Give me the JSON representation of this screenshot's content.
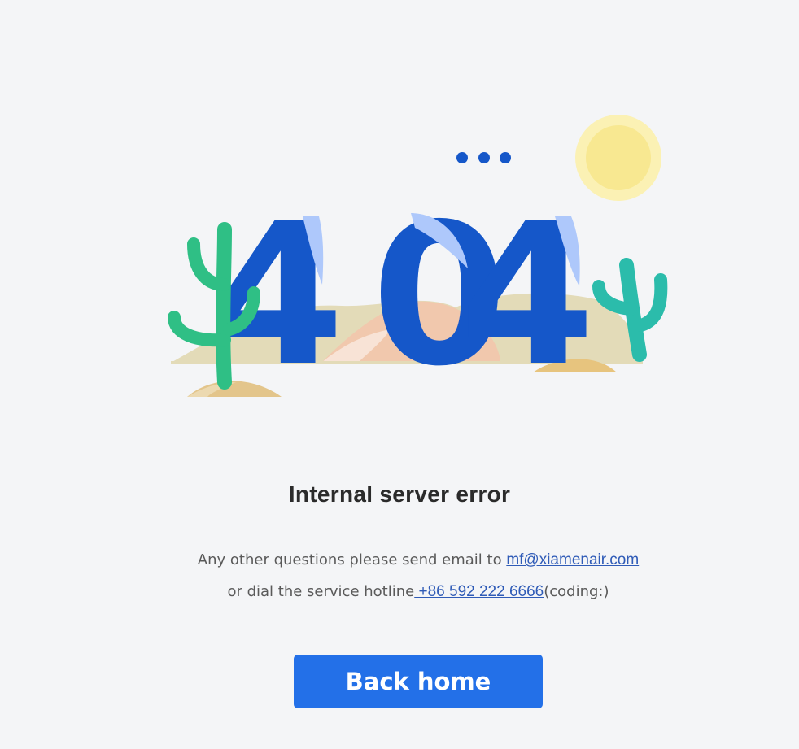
{
  "illustration": {
    "code": "404",
    "colors": {
      "digits": "#1557c9",
      "digit_highlight": "#aec8fb",
      "sun": "#f8e891",
      "sun_glow": "#fbf1b4",
      "cactus_left": "#2fbf85",
      "cactus_right": "#2bbcab",
      "sand": "#e3dbb8",
      "sand_pink": "#f1c8ad",
      "dune": "#e7c47e"
    }
  },
  "error": {
    "title": "Internal server error",
    "email_prefix": "Any other questions please send email to ",
    "email": "mf@xiamenair.com",
    "hotline_prefix": "or dial the service hotline",
    "hotline": " +86 592 222 6666",
    "hotline_suffix": "(coding:)"
  },
  "actions": {
    "back_home_label": "Back home"
  }
}
